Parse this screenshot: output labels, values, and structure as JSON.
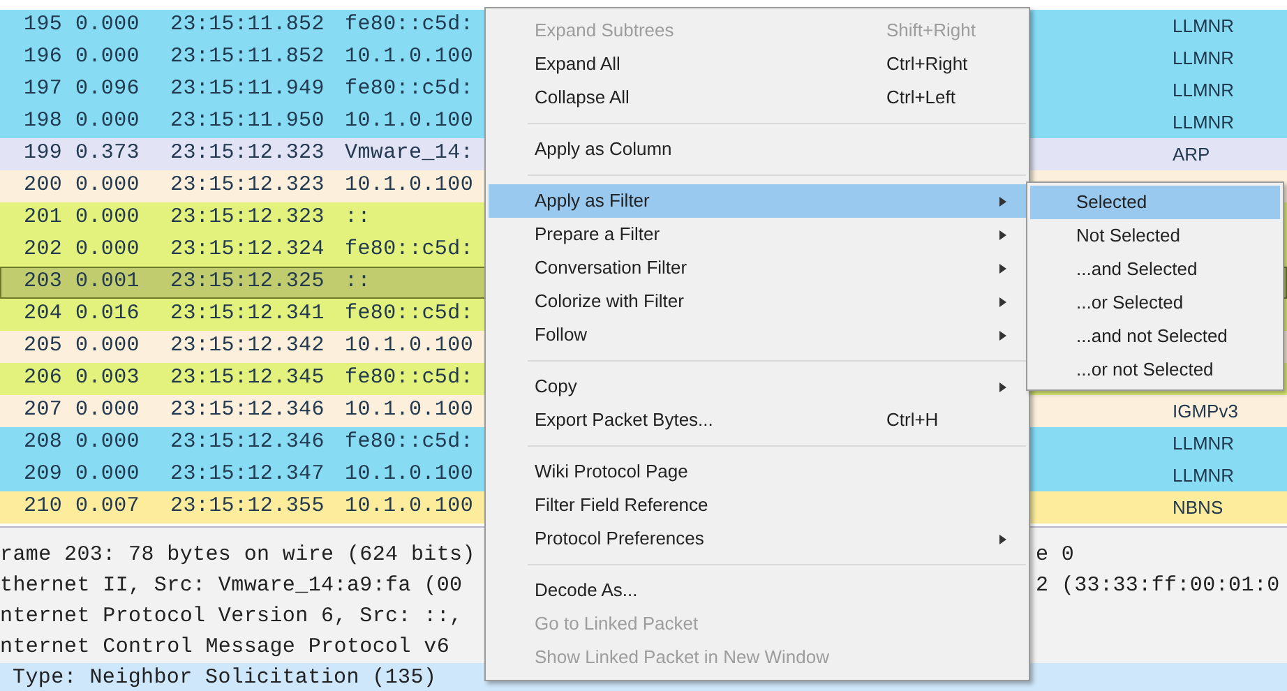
{
  "packet_list": [
    {
      "no": "195",
      "delta": "0.000",
      "time": "23:15:11.852",
      "source": "fe80::c5d:",
      "protocol": "LLMNR",
      "color": "#87dcf4",
      "selected": false
    },
    {
      "no": "196",
      "delta": "0.000",
      "time": "23:15:11.852",
      "source": "10.1.0.100",
      "protocol": "LLMNR",
      "color": "#87dcf4",
      "selected": false
    },
    {
      "no": "197",
      "delta": "0.096",
      "time": "23:15:11.949",
      "source": "fe80::c5d:",
      "protocol": "LLMNR",
      "color": "#87dcf4",
      "selected": false
    },
    {
      "no": "198",
      "delta": "0.000",
      "time": "23:15:11.950",
      "source": "10.1.0.100",
      "protocol": "LLMNR",
      "color": "#87dcf4",
      "selected": false
    },
    {
      "no": "199",
      "delta": "0.373",
      "time": "23:15:12.323",
      "source": "Vmware_14:",
      "protocol": "ARP",
      "color": "#e2e3f5",
      "selected": false
    },
    {
      "no": "200",
      "delta": "0.000",
      "time": "23:15:12.323",
      "source": "10.1.0.100",
      "color": "#fcf0dd",
      "selected": false
    },
    {
      "no": "201",
      "delta": "0.000",
      "time": "23:15:12.323",
      "source": "::",
      "color": "#e3f27c",
      "selected": false
    },
    {
      "no": "202",
      "delta": "0.000",
      "time": "23:15:12.324",
      "source": "fe80::c5d:",
      "color": "#e3f27c",
      "selected": false
    },
    {
      "no": "203",
      "delta": "0.001",
      "time": "23:15:12.325",
      "source": "::",
      "color": "#c1cc6e",
      "selected": true
    },
    {
      "no": "204",
      "delta": "0.016",
      "time": "23:15:12.341",
      "source": "fe80::c5d:",
      "color": "#e3f27c",
      "selected": false
    },
    {
      "no": "205",
      "delta": "0.000",
      "time": "23:15:12.342",
      "source": "10.1.0.100",
      "color": "#fcf0dd",
      "selected": false
    },
    {
      "no": "206",
      "delta": "0.003",
      "time": "23:15:12.345",
      "source": "fe80::c5d:",
      "color": "#e3f27c",
      "selected": false
    },
    {
      "no": "207",
      "delta": "0.000",
      "time": "23:15:12.346",
      "source": "10.1.0.100",
      "protocol": "IGMPv3",
      "color": "#fcf0dd",
      "selected": false
    },
    {
      "no": "208",
      "delta": "0.000",
      "time": "23:15:12.346",
      "source": "fe80::c5d:",
      "protocol": "LLMNR",
      "color": "#87dcf4",
      "selected": false
    },
    {
      "no": "209",
      "delta": "0.000",
      "time": "23:15:12.347",
      "source": "10.1.0.100",
      "protocol": "LLMNR",
      "color": "#87dcf4",
      "selected": false
    },
    {
      "no": "210",
      "delta": "0.007",
      "time": "23:15:12.355",
      "source": "10.1.0.100",
      "protocol": "NBNS",
      "color": "#fcec9c",
      "selected": false
    }
  ],
  "packet_details": [
    {
      "text": "rame 203: 78 bytes on wire (624 bits)",
      "text_right": "e 0",
      "selected": false,
      "indented": false
    },
    {
      "text": "thernet II, Src: Vmware_14:a9:fa (00",
      "text_right": "2 (33:33:ff:00:01:0",
      "selected": false,
      "indented": false
    },
    {
      "text": "nternet Protocol Version 6, Src: ::,",
      "selected": false,
      "indented": false
    },
    {
      "text": "nternet Control Message Protocol v6",
      "selected": false,
      "indented": false
    },
    {
      "text": "Type: Neighbor Solicitation (135)",
      "selected": true,
      "indented": true
    }
  ],
  "context_menu": {
    "groups": [
      [
        {
          "label": "Expand Subtrees",
          "shortcut": "Shift+Right",
          "disabled": true,
          "submenu": false,
          "selected": false
        },
        {
          "label": "Expand All",
          "shortcut": "Ctrl+Right",
          "disabled": false,
          "submenu": false,
          "selected": false
        },
        {
          "label": "Collapse All",
          "shortcut": "Ctrl+Left",
          "disabled": false,
          "submenu": false,
          "selected": false
        }
      ],
      [
        {
          "label": "Apply as Column",
          "disabled": false,
          "submenu": false,
          "selected": false
        }
      ],
      [
        {
          "label": "Apply as Filter",
          "disabled": false,
          "submenu": true,
          "selected": true
        },
        {
          "label": "Prepare a Filter",
          "disabled": false,
          "submenu": true,
          "selected": false
        },
        {
          "label": "Conversation Filter",
          "disabled": false,
          "submenu": true,
          "selected": false
        },
        {
          "label": "Colorize with Filter",
          "disabled": false,
          "submenu": true,
          "selected": false
        },
        {
          "label": "Follow",
          "disabled": false,
          "submenu": true,
          "selected": false
        }
      ],
      [
        {
          "label": "Copy",
          "disabled": false,
          "submenu": true,
          "selected": false
        },
        {
          "label": "Export Packet Bytes...",
          "shortcut": "Ctrl+H",
          "disabled": false,
          "submenu": false,
          "selected": false
        }
      ],
      [
        {
          "label": "Wiki Protocol Page",
          "disabled": false,
          "submenu": false,
          "selected": false
        },
        {
          "label": "Filter Field Reference",
          "disabled": false,
          "submenu": false,
          "selected": false
        },
        {
          "label": "Protocol Preferences",
          "disabled": false,
          "submenu": true,
          "selected": false
        }
      ],
      [
        {
          "label": "Decode As...",
          "disabled": false,
          "submenu": false,
          "selected": false
        },
        {
          "label": "Go to Linked Packet",
          "disabled": true,
          "submenu": false,
          "selected": false
        },
        {
          "label": "Show Linked Packet in New Window",
          "disabled": true,
          "submenu": false,
          "selected": false
        }
      ]
    ]
  },
  "submenu": {
    "items": [
      {
        "label": "Selected",
        "selected": true
      },
      {
        "label": "Not Selected",
        "selected": false
      },
      {
        "label": "...and Selected",
        "selected": false
      },
      {
        "label": "...or Selected",
        "selected": false
      },
      {
        "label": "...and not Selected",
        "selected": false
      },
      {
        "label": "...or not Selected",
        "selected": false
      }
    ]
  }
}
